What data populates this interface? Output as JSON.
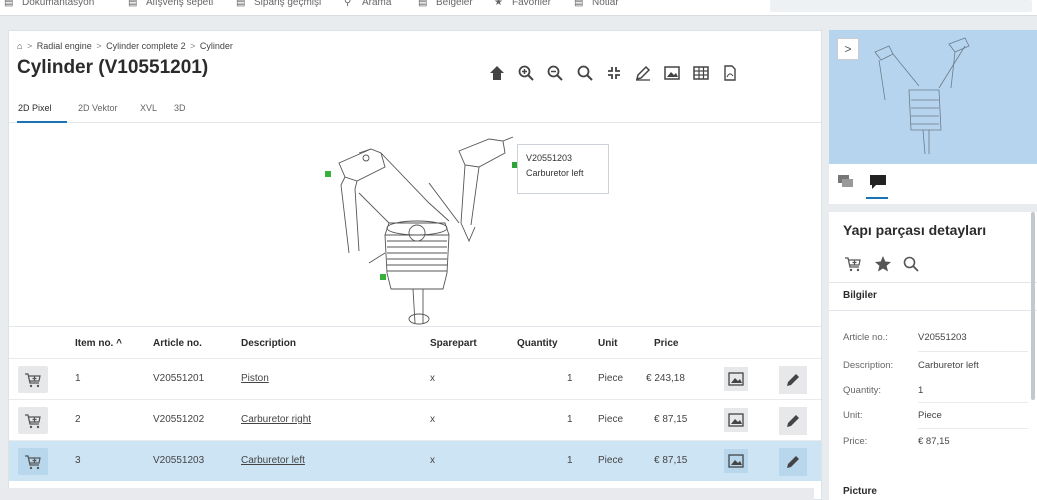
{
  "topnav": {
    "items": [
      {
        "label": "Dokümantasyon",
        "icon": "docs-icon"
      },
      {
        "label": "Alışveriş sepeti",
        "icon": "cart-icon"
      },
      {
        "label": "Sipariş geçmişi",
        "icon": "history-icon"
      },
      {
        "label": "Arama",
        "icon": "search-icon"
      },
      {
        "label": "Belgeler",
        "icon": "folder-icon"
      },
      {
        "label": "Favoriler",
        "icon": "star-icon"
      },
      {
        "label": "Notlar",
        "icon": "note-icon"
      }
    ]
  },
  "breadcrumb": {
    "home_icon": "home-icon",
    "items": [
      "Radial engine",
      "Cylinder complete 2",
      "Cylinder"
    ]
  },
  "page": {
    "title": "Cylinder (V10551201)"
  },
  "toolbar": {
    "icons": [
      "home-icon",
      "zoom-in-icon",
      "zoom-out-icon",
      "search-icon",
      "fit-icon",
      "pencil-icon",
      "image-icon",
      "table-icon",
      "pdf-icon"
    ]
  },
  "tabs": [
    "2D Pixel",
    "2D Vektor",
    "XVL",
    "3D"
  ],
  "tooltip": {
    "line1": "V20551203",
    "line2": "Carburetor left"
  },
  "table": {
    "headers": {
      "item_no": "Item no. ^",
      "article_no": "Article no.",
      "description": "Description",
      "sparepart": "Sparepart",
      "quantity": "Quantity",
      "unit": "Unit",
      "price": "Price"
    },
    "rows": [
      {
        "item_no": "1",
        "article_no": "V20551201",
        "description": "Piston",
        "sparepart": "x",
        "quantity": "1",
        "unit": "Piece",
        "price": "€ 243,18",
        "selected": false
      },
      {
        "item_no": "2",
        "article_no": "V20551202",
        "description": "Carburetor right",
        "sparepart": "x",
        "quantity": "1",
        "unit": "Piece",
        "price": "€ 87,15",
        "selected": false
      },
      {
        "item_no": "3",
        "article_no": "V20551203",
        "description": "Carburetor left",
        "sparepart": "x",
        "quantity": "1",
        "unit": "Piece",
        "price": "€ 87,15",
        "selected": true
      }
    ]
  },
  "right_panel": {
    "toggle_glyph": ">",
    "details_title": "Yapı parçası detayları",
    "info_section": "Bilgiler",
    "picture_section": "Picture",
    "fields": [
      {
        "key": "Article no.:",
        "value": "V20551203"
      },
      {
        "key": "Description:",
        "value": "Carburetor left"
      },
      {
        "key": "Quantity:",
        "value": "1"
      },
      {
        "key": "Unit:",
        "value": "Piece"
      },
      {
        "key": "Price:",
        "value": "€ 87,15"
      }
    ]
  },
  "colors": {
    "accent": "#1a73b7",
    "selected_row": "#cde4f4",
    "hotspot": "#35b13c",
    "preview_bg": "#b7d4ee"
  }
}
